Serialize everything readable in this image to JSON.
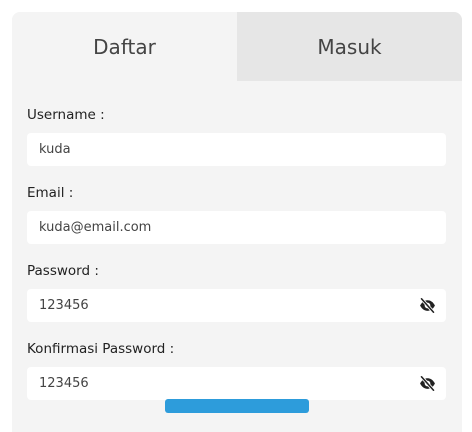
{
  "tabs": {
    "register": "Daftar",
    "login": "Masuk"
  },
  "form": {
    "username": {
      "label": "Username :",
      "value": "kuda"
    },
    "email": {
      "label": "Email :",
      "value": "kuda@email.com"
    },
    "password": {
      "label": "Password :",
      "value": "123456",
      "toggle_icon": "eye-slash-icon"
    },
    "confirm_password": {
      "label": "Konfirmasi Password :",
      "value": "123456",
      "toggle_icon": "eye-slash-icon"
    }
  },
  "colors": {
    "card_bg": "#f4f4f4",
    "inactive_tab_bg": "#e6e6e6",
    "accent": "#2d9cdb"
  }
}
